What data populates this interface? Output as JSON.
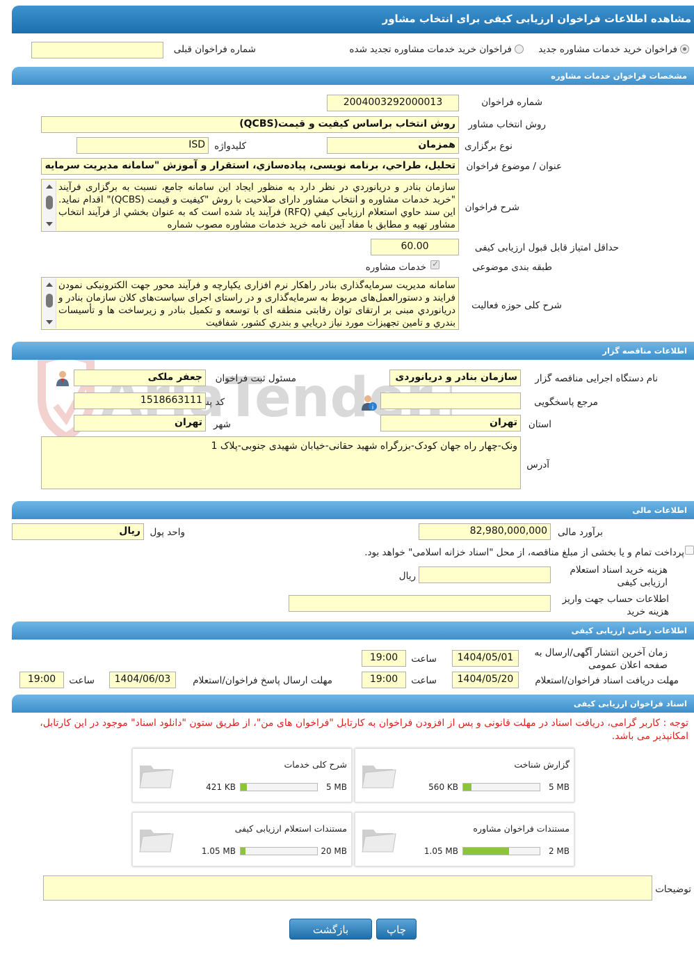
{
  "window_title": "مشاهده اطلاعات فراخوان ارزیابی کیفی برای انتخاب مشاور",
  "top": {
    "radio_new": "فراخوان خرید خدمات مشاوره جدید",
    "radio_renewed": "فراخوان خرید خدمات مشاوره تجدید شده",
    "prev_label": "شماره فراخوان قبلی",
    "prev_value": ""
  },
  "sections": {
    "spec": "مشخصات فراخوان خدمات مشاوره",
    "tender": "اطلاعات مناقصه گزار",
    "finance": "اطلاعات مالی",
    "timing": "اطلاعات زمانی ارزیابی کیفی",
    "docs": "اسناد فراخوان ارزیابی کیفی"
  },
  "spec": {
    "number_label": "شماره فراخوان",
    "number": "2004003292000013",
    "method_label": "روش انتخاب مشاور",
    "method": "روش انتخاب براساس کیفیت و قیمت(QCBS)",
    "type_label": "نوع برگزاری",
    "type": "همزمان",
    "keyword_label": "کلیدواژه",
    "keyword": "ISD",
    "subject_label": "عنوان / موضوع فراخوان",
    "subject": "تحلیل، طراحي، برنامه نویسی، پیاده‌سازي، استقرار و آموزش \"سامانه مدیریت سرمایه",
    "desc_label": "شرح فراخوان",
    "desc": "سازمان بنادر و دریانوردي در نظر دارد به منظور ایجاد این سامانه جامع، نسبت به برگزاری فرآیند \"خرید خدمات مشاوره و انتخاب مشاور دارای صلاحیت با روش \"کیفیت و قیمت (QCBS)\" اقدام نماید. این سند حاوي استعلام ارزیابی کیفي (RFQ) فرآیند یاد شده است که به عنوان بخشي از فرآیند انتخاب مشاور تهیه و مطابق با مفاد آیین نامه خرید خدمات مشاوره مصوب شماره",
    "min_score_label": "حداقل امتیاز قابل قبول ارزیابی کیفی",
    "min_score": "60.00",
    "category_label": "طبقه بندی موضوعی",
    "category": "خدمات مشاوره",
    "scope_label": "شرح کلی حوزه فعالیت",
    "scope": "سامانه مدیریت سرمایه‌گذاری بنادر راهکار نرم افزاری یکپارچه و فرآیند محور جهت الکترونیکی نمودن فرایند و دستورالعمل‌های مربوط به سرمایه‌گذاری و در راستای اجرای سیاست‌های کلان سازمان بنادر و دریانوردي مبنی بر ارتقای توان رقابتی منطقه ای با توسعه و تکمیل بنادر و زیرساخت ها و تأسیسات بندري و تامین تجهیزات مورد نیاز دریایي و بندري کشور، شفافیت"
  },
  "tender": {
    "org_label": "نام دستگاه اجرایی مناقصه گزار",
    "org": "سازمان بنادر و دریانوردی",
    "registrar_label": "مسئول ثبت فراخوان",
    "registrar": "جعفر ملکی",
    "ref_label": "مرجع پاسخگویی",
    "ref": "",
    "postal_label": "کد پستی",
    "postal": "1518663111",
    "province_label": "استان",
    "province": "تهران",
    "city_label": "شهر",
    "city": "تهران",
    "address_label": "آدرس",
    "address": "ونک-چهار راه جهان کودک-بزرگراه شهید حقانی-خیابان شهیدی جنوبی-پلاک 1"
  },
  "finance": {
    "estimate_label": "برآورد مالی",
    "estimate": "82,980,000,000",
    "currency_label": "واحد پول",
    "currency": "ریال",
    "treasury_text": "پرداخت تمام و یا بخشی از مبلغ مناقصه، از محل \"اسناد خزانه اسلامی\" خواهد بود.",
    "doc_fee_label": "هزینه خرید اسناد استعلام ارزیابی کیفی",
    "doc_fee": "",
    "doc_fee_unit": "ریال",
    "account_label": "اطلاعات حساب جهت واریز هزینه خرید",
    "account": ""
  },
  "timing": {
    "publish_label": "زمان آخرین انتشار آگهی/ارسال به صفحه اعلان عمومی",
    "publish_date": "1404/05/01",
    "publish_time": "19:00",
    "receive_label": "مهلت دریافت اسناد فراخوان/استعلام",
    "receive_date": "1404/05/20",
    "receive_time": "19:00",
    "reply_label": "مهلت ارسال پاسخ فراخوان/استعلام",
    "reply_date": "1404/06/03",
    "reply_time": "19:00",
    "time_label": "ساعت"
  },
  "docs_note": "توجه : کاربر گرامی، دریافت اسناد در مهلت قانونی و پس از افزودن فراخوان به کارتابل \"فراخوان های من\"، از طریق ستون \"دانلود اسناد\" موجود در این کارتابل، امکانپذیر می باشد.",
  "documents": [
    {
      "name": "گزارش شناخت",
      "size": "560 KB",
      "max": "5 MB",
      "fill": 0.11
    },
    {
      "name": "شرح کلی خدمات",
      "size": "421 KB",
      "max": "5 MB",
      "fill": 0.08
    },
    {
      "name": "مستندات فراخوان مشاوره",
      "size": "1.05 MB",
      "max": "2 MB",
      "fill": 0.6
    },
    {
      "name": "مستندات استعلام ارزیابی کیفی",
      "size": "1.05 MB",
      "max": "20 MB",
      "fill": 0.06
    }
  ],
  "remarks_label": "توضیحات",
  "remarks": "",
  "buttons": {
    "print": "چاپ",
    "back": "بازگشت"
  },
  "watermark": "AriaTender.neT",
  "colors": {
    "header": "#1b6fad",
    "field": "#ffffcc",
    "note": "#e0201a",
    "progress": "#8cc43c"
  }
}
